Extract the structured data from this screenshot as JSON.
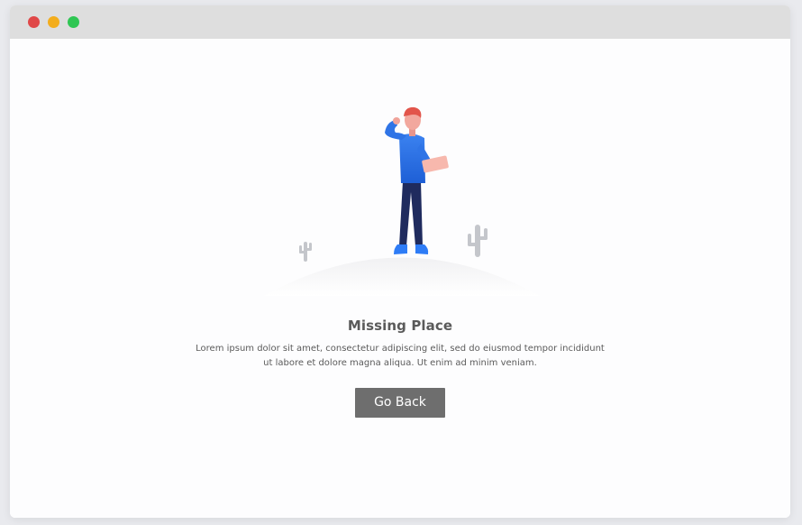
{
  "window": {
    "controls": {
      "close_color": "#e04848",
      "minimize_color": "#f3ad1c",
      "zoom_color": "#2fc653"
    }
  },
  "illustration": {
    "icon": "person-confused-in-desert-icon",
    "cactus_icon": "cactus-icon"
  },
  "main": {
    "title": "Missing Place",
    "description_line1": "Lorem ipsum dolor sit amet, consectetur adipiscing elit, sed do eiusmod tempor incididunt",
    "description_line2": "ut labore et dolore magna aliqua. Ut enim ad minim veniam.",
    "button_label": "Go Back",
    "button_color": "#6e6e6e"
  }
}
